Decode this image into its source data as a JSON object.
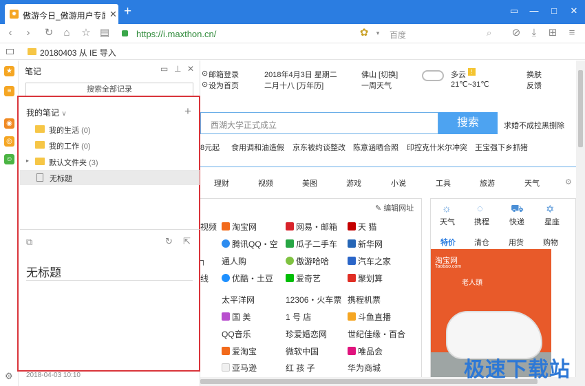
{
  "browser": {
    "tab_title": "傲游今日_傲游用户专属…",
    "url": "https://i.maxthon.cn/",
    "search_placeholder": "百度",
    "accent": "#2b7de1"
  },
  "bookmarks_bar": {
    "folder_label": "20180403 从 IE 导入"
  },
  "notes_panel": {
    "title": "笔记",
    "search_all": "搜索全部记录",
    "my_notes": "我的笔记",
    "folders": [
      {
        "label": "我的生活",
        "count": "(0)"
      },
      {
        "label": "我的工作",
        "count": "(0)"
      },
      {
        "label": "默认文件夹",
        "count": "(3)"
      }
    ],
    "selected_note": "无标题",
    "note_title": "无标题",
    "timestamp": "2018-04-03 10:10",
    "frame_color": "#d9343a"
  },
  "homepage": {
    "top_links": [
      "邮箱登录",
      "设为首页"
    ],
    "date": "2018年4月3日 星期二",
    "lunar": "二月十八 [万年历]",
    "city": "佛山 [切换]",
    "week_weather": "一周天气",
    "weather": "多云",
    "temp": "21℃~31℃",
    "skin": "换肤",
    "feedback": "反馈",
    "search_placeholder": "西湖大学正式成立",
    "search_button": "搜索",
    "search_side_link": "求婚不成拉黑捌除",
    "hot_news": [
      "8元起",
      "食用调和油造假",
      "京东被约谈整改",
      "陈意涵晒合照",
      "印控克什米尔冲突",
      "王宝强下乡抓猪"
    ],
    "categories": [
      "理财",
      "视频",
      "美图",
      "游戏",
      "小说",
      "工具",
      "旅游",
      "天气"
    ],
    "edit_sites": "编辑网址",
    "sites": [
      [
        "视频",
        "淘宝网",
        "网易・邮箱",
        "天 猫"
      ],
      [
        "",
        "腾讯QQ・空",
        "瓜子二手车",
        "新华网"
      ],
      [
        "",
        "通人购",
        "傲游哈哈",
        "汽车之家"
      ],
      [
        "线",
        "优酷・土豆",
        "爱奇艺",
        "聚划算"
      ],
      [
        "",
        "太平洋网",
        "12306・火车票",
        "携程机票"
      ],
      [
        "",
        "国 美",
        "1 号 店",
        "斗鱼直播"
      ],
      [
        "",
        "QQ音乐",
        "珍爱婚恋网",
        "世纪佳缘・百合"
      ],
      [
        "",
        "爱淘宝",
        "微软中国",
        "唯品会"
      ],
      [
        "",
        "亚马逊",
        "红 孩 子",
        "华为商城"
      ]
    ],
    "right_tools": [
      "天气",
      "携程",
      "快递",
      "星座"
    ],
    "right_tabs": [
      "特价",
      "清仓",
      "用货",
      "购物"
    ],
    "ad_brand": "淘宝网",
    "ad_domain": "Taobao.com",
    "ad_product": "老人頭"
  },
  "watermark": "极速下载站"
}
